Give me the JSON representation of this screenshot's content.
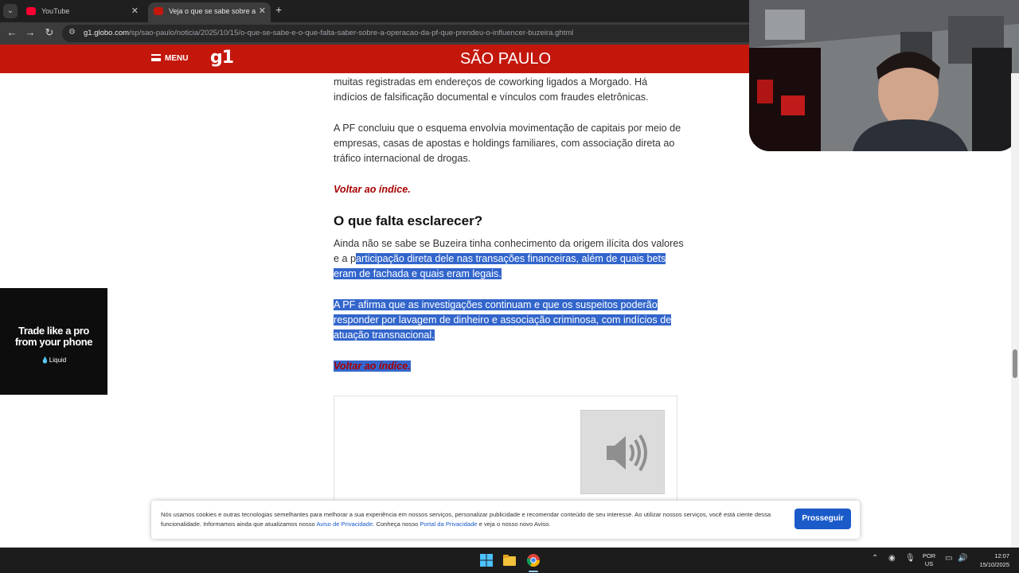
{
  "browser": {
    "tabs": [
      {
        "title": "YouTube",
        "favicon": "youtube-icon",
        "favicon_color": "#ff0033"
      },
      {
        "title": "Veja o que se sabe sobre a operação",
        "favicon": "g1-icon",
        "favicon_color": "#c4170c"
      }
    ],
    "new_tab": "+",
    "url_domain": "g1.globo.com",
    "url_path": "/sp/sao-paulo/noticia/2025/10/15/o-que-se-sabe-e-o-que-falta-saber-sobre-a-operacao-da-pf-que-prendeu-o-influencer-buzeira.ghtml"
  },
  "site_header": {
    "menu_label": "MENU",
    "logo": "g1",
    "section": "SÃO PAULO",
    "brand_color": "#c4170c"
  },
  "article": {
    "p1": "muitas registradas em endereços de coworking ligados a Morgado. Há indícios de falsificação documental e vínculos com fraudes eletrônicas.",
    "p2": "A PF concluiu que o esquema envolvia movimentação de capitais por meio de empresas, casas de apostas e holdings familiares, com associação direta ao tráfico internacional de drogas.",
    "back_link": "Voltar ao índice.",
    "h2": "O que falta esclarecer?",
    "p3_plain": "Ainda não se sabe se Buzeira tinha conhecimento da origem ilícita dos valores e a p",
    "p3_selected": "articipação direta dele nas transações financeiras, além de quais bets eram de fachada e quais eram legais.",
    "p4": "A PF afirma que as investigações continuam e que os suspeitos poderão responder por lavagem de dinheiro e associação criminosa, com indícios de atuação transnacional.",
    "back_link_2": "Voltar ao índice.",
    "selection_color": "#3366cc"
  },
  "ad": {
    "line1": "Trade like a pro",
    "line2": "from your phone",
    "brand": "Liquid"
  },
  "cookie_banner": {
    "text_1": "Nós usamos cookies e outras tecnologias semelhantes para melhorar a sua experiência em nossos serviços, personalizar publicidade e recomendar conteúdo de seu interesse. Ao utilizar nossos serviços, você está ciente dessa funcionalidade. Informamos ainda que atualizamos nosso ",
    "link_1": "Aviso de Privacidade",
    "text_2": ". Conheça nosso ",
    "link_2": "Portal da Privacidade",
    "text_3": " e veja o nosso novo Aviso.",
    "button": "Prosseguir",
    "button_color": "#1a5ac9"
  },
  "taskbar": {
    "lang_1": "POR",
    "lang_2": "US",
    "time": "12:07",
    "date": "15/10/2025"
  }
}
